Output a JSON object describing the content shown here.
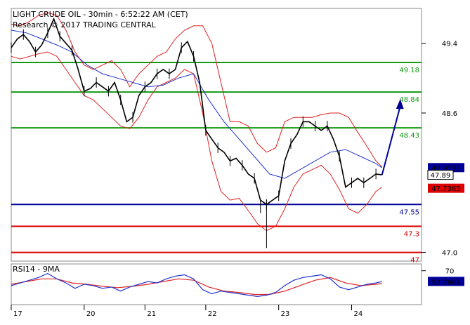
{
  "header": {
    "line1": "LIGHT CRUDE OIL - 30min - 6:52:22 AM (CET)",
    "line2": "Research © 2017 TRADING CENTRAL"
  },
  "rsi_header": "RSI14 - 9MA",
  "colors": {
    "price": "#000000",
    "bollinger": "#dd2222",
    "ma": "#2233cc",
    "resistance": "#119911",
    "support_blue": "#000099",
    "support_red": "#dd0000",
    "arrow": "#000099",
    "badge_blue": "#000099",
    "badge_red": "#dd0000"
  },
  "chart_data": {
    "type": "line",
    "title": "LIGHT CRUDE OIL - 30min - 6:52:22 AM (CET)",
    "x_tick_labels": [
      "17",
      "20",
      "21",
      "22",
      "23",
      "24"
    ],
    "y_tick_labels": [
      "49.4",
      "48.6",
      "47.0"
    ],
    "ylim": [
      46.9,
      49.8
    ],
    "levels": [
      {
        "label": "49.18",
        "value": 49.18,
        "color": "#119911"
      },
      {
        "label": "48.84",
        "value": 48.84,
        "color": "#119911"
      },
      {
        "label": "48.43",
        "value": 48.43,
        "color": "#119911"
      },
      {
        "label": "47.55",
        "value": 47.55,
        "color": "#000099"
      },
      {
        "label": "47.3",
        "value": 47.3,
        "color": "#dd0000"
      },
      {
        "label": "47",
        "value": 47.0,
        "color": "#dd0000"
      }
    ],
    "badges": [
      {
        "label": "47.9732",
        "value": 47.9732,
        "color": "#000099",
        "style": "filled"
      },
      {
        "label": "47.89",
        "value": 47.89,
        "color": "#000000",
        "style": "outline"
      },
      {
        "label": "47.7365",
        "value": 47.7365,
        "color": "#dd0000",
        "style": "filled"
      }
    ],
    "price": [
      [
        0,
        49.35
      ],
      [
        4,
        49.45
      ],
      [
        8,
        49.5
      ],
      [
        12,
        49.42
      ],
      [
        16,
        49.3
      ],
      [
        20,
        49.38
      ],
      [
        24,
        49.52
      ],
      [
        28,
        49.68
      ],
      [
        32,
        49.48
      ],
      [
        36,
        49.4
      ],
      [
        40,
        49.32
      ],
      [
        44,
        49.1
      ],
      [
        48,
        48.85
      ],
      [
        52,
        48.88
      ],
      [
        56,
        48.95
      ],
      [
        60,
        48.9
      ],
      [
        64,
        48.85
      ],
      [
        68,
        48.95
      ],
      [
        72,
        48.75
      ],
      [
        76,
        48.5
      ],
      [
        80,
        48.55
      ],
      [
        84,
        48.8
      ],
      [
        88,
        48.9
      ],
      [
        92,
        48.95
      ],
      [
        96,
        49.05
      ],
      [
        100,
        49.1
      ],
      [
        104,
        49.05
      ],
      [
        108,
        49.1
      ],
      [
        112,
        49.35
      ],
      [
        116,
        49.42
      ],
      [
        120,
        49.25
      ],
      [
        124,
        48.95
      ],
      [
        128,
        48.4
      ],
      [
        132,
        48.3
      ],
      [
        136,
        48.2
      ],
      [
        140,
        48.15
      ],
      [
        144,
        48.05
      ],
      [
        148,
        48.08
      ],
      [
        152,
        48.0
      ],
      [
        156,
        47.9
      ],
      [
        160,
        47.85
      ],
      [
        164,
        47.6
      ],
      [
        168,
        47.55
      ],
      [
        172,
        47.6
      ],
      [
        176,
        47.65
      ],
      [
        180,
        48.05
      ],
      [
        184,
        48.25
      ],
      [
        188,
        48.35
      ],
      [
        192,
        48.5
      ],
      [
        196,
        48.5
      ],
      [
        200,
        48.45
      ],
      [
        204,
        48.4
      ],
      [
        208,
        48.45
      ],
      [
        212,
        48.3
      ],
      [
        216,
        48.1
      ],
      [
        220,
        47.75
      ],
      [
        224,
        47.8
      ],
      [
        228,
        47.85
      ],
      [
        232,
        47.8
      ],
      [
        236,
        47.85
      ],
      [
        240,
        47.9
      ],
      [
        244,
        47.89
      ]
    ],
    "price_low": [
      [
        164,
        47.45
      ],
      [
        168,
        47.05
      ]
    ],
    "bb_upper": [
      [
        0,
        49.62
      ],
      [
        6,
        49.6
      ],
      [
        12,
        49.65
      ],
      [
        18,
        49.72
      ],
      [
        24,
        49.75
      ],
      [
        30,
        49.72
      ],
      [
        36,
        49.55
      ],
      [
        42,
        49.3
      ],
      [
        48,
        49.15
      ],
      [
        54,
        49.1
      ],
      [
        60,
        49.15
      ],
      [
        66,
        49.2
      ],
      [
        72,
        49.1
      ],
      [
        78,
        48.9
      ],
      [
        84,
        49.05
      ],
      [
        90,
        49.15
      ],
      [
        96,
        49.25
      ],
      [
        102,
        49.3
      ],
      [
        108,
        49.45
      ],
      [
        114,
        49.55
      ],
      [
        120,
        49.6
      ],
      [
        126,
        49.6
      ],
      [
        132,
        49.4
      ],
      [
        138,
        48.95
      ],
      [
        144,
        48.5
      ],
      [
        150,
        48.5
      ],
      [
        156,
        48.45
      ],
      [
        162,
        48.25
      ],
      [
        168,
        48.15
      ],
      [
        174,
        48.2
      ],
      [
        180,
        48.5
      ],
      [
        186,
        48.55
      ],
      [
        192,
        48.55
      ],
      [
        198,
        48.55
      ],
      [
        204,
        48.58
      ],
      [
        210,
        48.6
      ],
      [
        216,
        48.6
      ],
      [
        222,
        48.55
      ],
      [
        228,
        48.38
      ],
      [
        234,
        48.22
      ],
      [
        240,
        48.05
      ],
      [
        244,
        47.98
      ]
    ],
    "bb_lower": [
      [
        0,
        49.25
      ],
      [
        6,
        49.22
      ],
      [
        12,
        49.25
      ],
      [
        18,
        49.28
      ],
      [
        24,
        49.3
      ],
      [
        30,
        49.25
      ],
      [
        36,
        49.1
      ],
      [
        42,
        48.95
      ],
      [
        48,
        48.8
      ],
      [
        54,
        48.75
      ],
      [
        60,
        48.65
      ],
      [
        66,
        48.55
      ],
      [
        72,
        48.45
      ],
      [
        78,
        48.42
      ],
      [
        84,
        48.55
      ],
      [
        90,
        48.75
      ],
      [
        96,
        48.9
      ],
      [
        102,
        48.95
      ],
      [
        108,
        49.0
      ],
      [
        114,
        49.1
      ],
      [
        120,
        49.05
      ],
      [
        126,
        48.6
      ],
      [
        132,
        48.05
      ],
      [
        138,
        47.7
      ],
      [
        144,
        47.6
      ],
      [
        150,
        47.62
      ],
      [
        156,
        47.48
      ],
      [
        162,
        47.33
      ],
      [
        168,
        47.25
      ],
      [
        174,
        47.3
      ],
      [
        180,
        47.5
      ],
      [
        186,
        47.75
      ],
      [
        192,
        47.9
      ],
      [
        198,
        47.95
      ],
      [
        204,
        48.0
      ],
      [
        210,
        47.9
      ],
      [
        216,
        47.72
      ],
      [
        222,
        47.5
      ],
      [
        228,
        47.45
      ],
      [
        234,
        47.55
      ],
      [
        240,
        47.7
      ],
      [
        244,
        47.75
      ]
    ],
    "ma": [
      [
        0,
        49.55
      ],
      [
        10,
        49.52
      ],
      [
        20,
        49.45
      ],
      [
        30,
        49.38
      ],
      [
        40,
        49.3
      ],
      [
        50,
        49.15
      ],
      [
        60,
        49.05
      ],
      [
        70,
        49.0
      ],
      [
        80,
        48.95
      ],
      [
        90,
        48.9
      ],
      [
        100,
        48.92
      ],
      [
        110,
        49.0
      ],
      [
        120,
        49.05
      ],
      [
        130,
        48.75
      ],
      [
        140,
        48.5
      ],
      [
        150,
        48.3
      ],
      [
        160,
        48.1
      ],
      [
        170,
        47.9
      ],
      [
        180,
        47.85
      ],
      [
        190,
        47.95
      ],
      [
        200,
        48.05
      ],
      [
        210,
        48.15
      ],
      [
        220,
        48.18
      ],
      [
        230,
        48.1
      ],
      [
        240,
        48.02
      ],
      [
        244,
        47.97
      ]
    ],
    "arrow": {
      "from": [
        244,
        47.89
      ],
      "to": [
        256,
        48.76
      ]
    },
    "rsi": {
      "label": "RSI14 - 9MA",
      "ylim": [
        20,
        80
      ],
      "tick_labels": [
        "70"
      ],
      "badge": {
        "label": "53.7667",
        "value": 53.7667
      },
      "rsi_values": [
        [
          0,
          48
        ],
        [
          6,
          52
        ],
        [
          12,
          56
        ],
        [
          18,
          60
        ],
        [
          24,
          66
        ],
        [
          30,
          58
        ],
        [
          36,
          52
        ],
        [
          42,
          44
        ],
        [
          48,
          50
        ],
        [
          54,
          48
        ],
        [
          60,
          44
        ],
        [
          66,
          46
        ],
        [
          72,
          40
        ],
        [
          78,
          46
        ],
        [
          84,
          50
        ],
        [
          90,
          54
        ],
        [
          96,
          52
        ],
        [
          102,
          58
        ],
        [
          108,
          62
        ],
        [
          114,
          64
        ],
        [
          120,
          58
        ],
        [
          126,
          42
        ],
        [
          132,
          36
        ],
        [
          138,
          40
        ],
        [
          144,
          38
        ],
        [
          150,
          36
        ],
        [
          156,
          34
        ],
        [
          162,
          32
        ],
        [
          168,
          34
        ],
        [
          174,
          38
        ],
        [
          180,
          48
        ],
        [
          186,
          56
        ],
        [
          192,
          60
        ],
        [
          198,
          62
        ],
        [
          204,
          64
        ],
        [
          210,
          58
        ],
        [
          216,
          46
        ],
        [
          222,
          42
        ],
        [
          228,
          46
        ],
        [
          234,
          50
        ],
        [
          240,
          52
        ],
        [
          244,
          54
        ]
      ],
      "ma_values": [
        [
          0,
          50
        ],
        [
          10,
          54
        ],
        [
          20,
          58
        ],
        [
          30,
          58
        ],
        [
          40,
          52
        ],
        [
          50,
          50
        ],
        [
          60,
          47
        ],
        [
          70,
          45
        ],
        [
          80,
          47
        ],
        [
          90,
          50
        ],
        [
          100,
          54
        ],
        [
          110,
          58
        ],
        [
          120,
          56
        ],
        [
          130,
          46
        ],
        [
          140,
          40
        ],
        [
          150,
          38
        ],
        [
          160,
          35
        ],
        [
          170,
          35
        ],
        [
          180,
          40
        ],
        [
          190,
          48
        ],
        [
          200,
          56
        ],
        [
          210,
          60
        ],
        [
          220,
          52
        ],
        [
          230,
          48
        ],
        [
          240,
          50
        ],
        [
          244,
          51
        ]
      ]
    }
  }
}
